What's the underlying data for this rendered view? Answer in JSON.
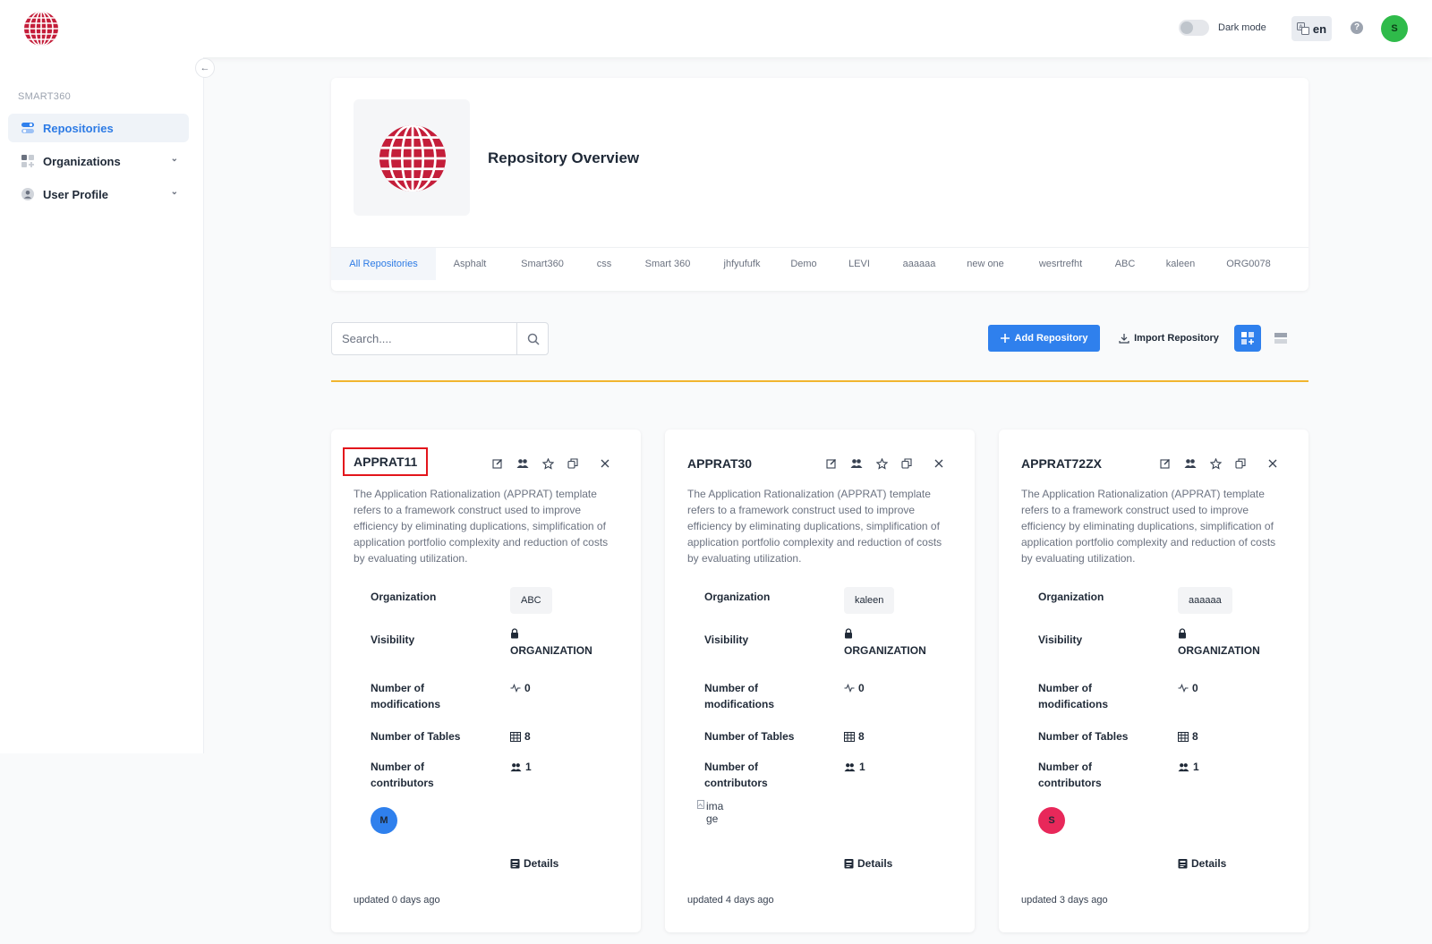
{
  "header": {
    "dark_mode_label": "Dark mode",
    "language": "en",
    "help_icon": "?",
    "user_initial": "S"
  },
  "sidebar": {
    "section_title": "SMART360",
    "items": [
      {
        "label": "Repositories",
        "icon": "repositories-icon",
        "active": true
      },
      {
        "label": "Organizations",
        "icon": "organizations-icon",
        "has_chevron": true
      },
      {
        "label": "User Profile",
        "icon": "user-profile-icon",
        "has_chevron": true
      }
    ]
  },
  "overview": {
    "title": "Repository Overview",
    "tabs": [
      "All Repositories",
      "Asphalt",
      "Smart360",
      "css",
      "Smart 360",
      "jhfyufufk",
      "Demo",
      "LEVI",
      "aaaaaa",
      "new one",
      "wesrtrefht",
      "ABC",
      "kaleen",
      "ORG0078"
    ],
    "active_tab": "All Repositories"
  },
  "toolbar": {
    "search_placeholder": "Search....",
    "add_label": "Add Repository",
    "import_label": "Import Repository"
  },
  "labels": {
    "organization": "Organization",
    "visibility": "Visibility",
    "modifications": "Number of modifications",
    "tables": "Number of Tables",
    "contributors": "Number of contributors",
    "details": "Details"
  },
  "cards": [
    {
      "name": "APPRAT11",
      "description": "The Application Rationalization (APPRAT) template refers to a framework construct used to improve efficiency by eliminating duplications, simplification of application portfolio complexity and reduction of costs by evaluating utilization.",
      "organization": "ABC",
      "visibility": "ORGANIZATION",
      "modifications": "0",
      "tables": "8",
      "contributors": "1",
      "contributor_avatar": "M",
      "avatar_color": "#2f80ed",
      "updated": "updated 0 days ago"
    },
    {
      "name": "APPRAT30",
      "description": "The Application Rationalization (APPRAT) template refers to a framework construct used to improve efficiency by eliminating duplications, simplification of application portfolio complexity and reduction of costs by evaluating utilization.",
      "organization": "kaleen",
      "visibility": "ORGANIZATION",
      "modifications": "0",
      "tables": "8",
      "contributors": "1",
      "contributor_image_alt": "image",
      "updated": "updated 4 days ago"
    },
    {
      "name": "APPRAT72ZX",
      "description": "The Application Rationalization (APPRAT) template refers to a framework construct used to improve efficiency by eliminating duplications, simplification of application portfolio complexity and reduction of costs by evaluating utilization.",
      "organization": "aaaaaa",
      "visibility": "ORGANIZATION",
      "modifications": "0",
      "tables": "8",
      "contributors": "1",
      "contributor_avatar": "S",
      "avatar_color": "#e8285a",
      "updated": "updated 3 days ago"
    }
  ],
  "colors": {
    "primary": "#2f80ed",
    "brand_red": "#c41e3a",
    "divider": "#f1b52f",
    "highlight": "#e3151c"
  }
}
